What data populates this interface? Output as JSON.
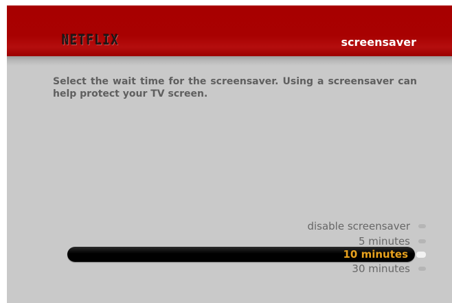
{
  "header": {
    "logo": "NETFLIX",
    "title": "screensaver"
  },
  "description": "Select the wait time for the screensaver. Using a screensaver can help protect your TV screen.",
  "options": [
    {
      "label": "disable screensaver",
      "selected": false
    },
    {
      "label": "5 minutes",
      "selected": false
    },
    {
      "label": "10 minutes",
      "selected": true
    },
    {
      "label": "30 minutes",
      "selected": false
    }
  ],
  "colors": {
    "header_red": "#a70000",
    "background_gray": "#c9c9c9",
    "selected_text": "#e8a21e",
    "option_text": "#676767"
  }
}
